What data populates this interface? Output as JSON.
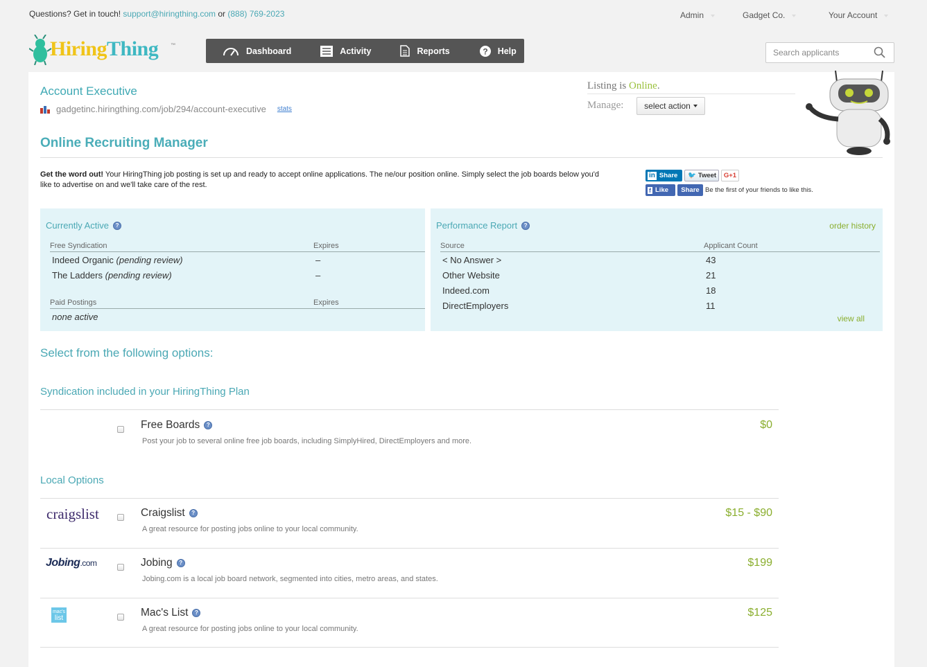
{
  "topbar": {
    "question": "Questions? Get in touch!",
    "email": "support@hiringthing.com",
    "or": "or",
    "phone": "(888) 769-2023"
  },
  "top_menu": [
    {
      "label": "Admin"
    },
    {
      "label": "Gadget Co."
    },
    {
      "label": "Your Account"
    }
  ],
  "logo": {
    "part1": "Hiring",
    "part2": "Thing",
    "tm": "™"
  },
  "nav": {
    "dashboard": "Dashboard",
    "activity": "Activity",
    "reports": "Reports",
    "help": "Help"
  },
  "search": {
    "placeholder": "Search applicants"
  },
  "job": {
    "title": "Account Executive",
    "url": "gadgetinc.hiringthing.com/job/294/account-executive",
    "stats": "stats"
  },
  "listing": {
    "prefix": "Listing is",
    "status": "Online",
    "suffix": ".",
    "manage_label": "Manage:",
    "select_action": "select action"
  },
  "orm": {
    "title": "Online Recruiting Manager",
    "intro_bold": "Get the word out!",
    "intro_text": " Your HiringThing job posting is set up and ready to accept online applications. The ne/our position online. Simply select the job boards below you'd like to advertise on and we'll take care of the rest."
  },
  "social": {
    "li_share": "Share",
    "tweet": "Tweet",
    "gplus": "G+1",
    "fb_like": "Like",
    "fb_share": "Share",
    "fb_text": "Be the first of your friends to like this."
  },
  "active": {
    "title": "Currently Active",
    "free_head": "Free Syndication",
    "expires_head": "Expires",
    "free_rows": [
      {
        "name": "Indeed Organic",
        "note": "(pending review)",
        "expires": "–"
      },
      {
        "name": "The Ladders",
        "note": "(pending review)",
        "expires": "–"
      }
    ],
    "paid_head": "Paid Postings",
    "paid_expires_head": "Expires",
    "paid_none": "none active"
  },
  "performance": {
    "title": "Performance Report",
    "order_history": "order history",
    "source_head": "Source",
    "count_head": "Applicant Count",
    "rows": [
      {
        "source": "< No Answer >",
        "count": "43"
      },
      {
        "source": "Other Website",
        "count": "21"
      },
      {
        "source": "Indeed.com",
        "count": "18"
      },
      {
        "source": "DirectEmployers",
        "count": "11"
      }
    ],
    "view_all": "view all"
  },
  "options": {
    "heading": "Select from the following options:",
    "syndication_head": "Syndication included in your HiringThing Plan",
    "local_head": "Local Options",
    "free_boards": {
      "name": "Free Boards",
      "desc": "Post your job to several online free job boards, including SimplyHired, DirectEmployers and more.",
      "price": "$0"
    },
    "craigslist": {
      "logo": "craigslist",
      "name": "Craigslist",
      "desc": "A great resource for posting jobs online to your local community.",
      "price": "$15 - $90"
    },
    "jobing": {
      "logo": "Jobing",
      "logo_suffix": ".com",
      "name": "Jobing",
      "desc": "Jobing.com is a local job board network, segmented into cities, metro areas, and states.",
      "price": "$199"
    },
    "macslist": {
      "logo_top": "mac's",
      "logo_bottom": "list",
      "name": "Mac's List",
      "desc": "A great resource for posting jobs online to your local community.",
      "price": "$125"
    }
  },
  "colors": {
    "accent": "#4aa8b4",
    "price_green": "#8aae2e",
    "nav_bg": "#555555",
    "panel_bg": "#e3f4f8"
  }
}
